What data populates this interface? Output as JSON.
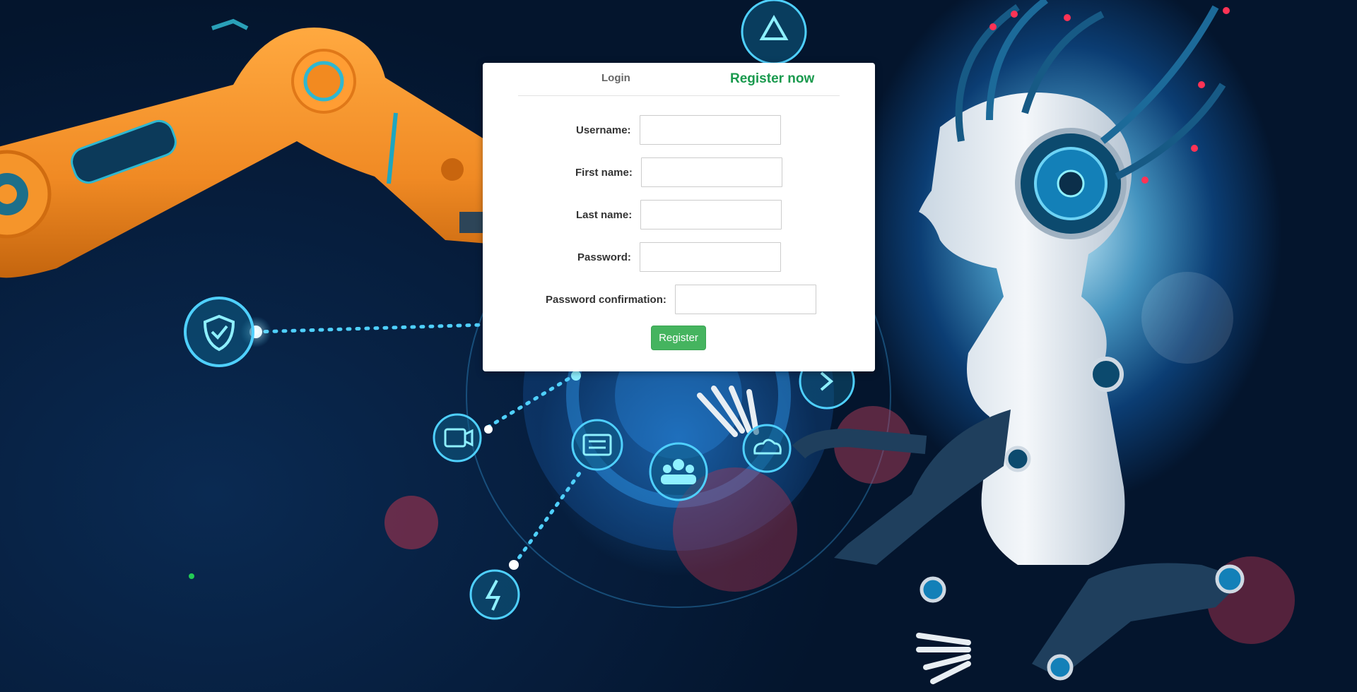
{
  "tabs": {
    "login_label": "Login",
    "register_label": "Register now"
  },
  "form": {
    "username_label": "Username:",
    "username_value": "",
    "first_name_label": "First name:",
    "first_name_value": "",
    "last_name_label": "Last name:",
    "last_name_value": "",
    "password_label": "Password:",
    "password_value": "",
    "password_confirmation_label": "Password confirmation:",
    "password_confirmation_value": "",
    "submit_label": "Register"
  },
  "colors": {
    "active_tab": "#1a9a4e",
    "inactive_tab": "#666666",
    "submit_button": "#45b45f",
    "robot_arm": "#f08a24",
    "background": "#061d3c"
  },
  "icons": [
    "recycle-icon",
    "shield-check-icon",
    "camera-icon",
    "document-icon",
    "team-icon",
    "cloud-icon",
    "lightning-icon",
    "chevron-right-icon"
  ]
}
